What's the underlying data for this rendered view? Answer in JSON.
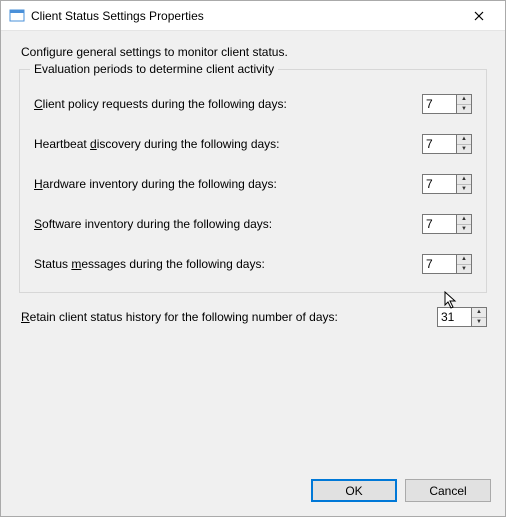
{
  "window": {
    "title": "Client Status Settings Properties"
  },
  "intro": "Configure general settings to monitor client status.",
  "group": {
    "legend": "Evaluation periods to determine client activity",
    "rows": {
      "policy": {
        "pre": "",
        "u": "C",
        "post": "lient policy requests during the following days:",
        "value": "7"
      },
      "heartbeat": {
        "pre": "Heartbeat ",
        "u": "d",
        "post": "iscovery during the following days:",
        "value": "7"
      },
      "hardware": {
        "pre": "",
        "u": "H",
        "post": "ardware inventory during the following days:",
        "value": "7"
      },
      "software": {
        "pre": "",
        "u": "S",
        "post": "oftware inventory during the following days:",
        "value": "7"
      },
      "status": {
        "pre": "Status ",
        "u": "m",
        "post": "essages during the following days:",
        "value": "7"
      }
    }
  },
  "history": {
    "pre": "",
    "u": "R",
    "post": "etain client status history for the following number of days:",
    "value": "31"
  },
  "buttons": {
    "ok": "OK",
    "cancel": "Cancel"
  }
}
